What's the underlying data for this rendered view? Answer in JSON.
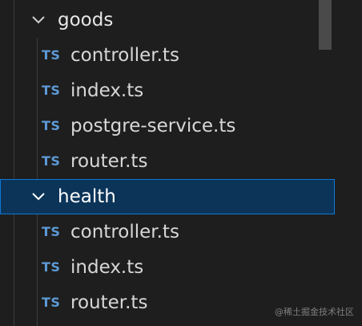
{
  "explorer": {
    "folders": [
      {
        "name": "goods",
        "expanded": true,
        "selected": false,
        "files": [
          {
            "icon": "TS",
            "name": "controller.ts"
          },
          {
            "icon": "TS",
            "name": "index.ts"
          },
          {
            "icon": "TS",
            "name": "postgre-service.ts"
          },
          {
            "icon": "TS",
            "name": "router.ts"
          }
        ]
      },
      {
        "name": "health",
        "expanded": true,
        "selected": true,
        "files": [
          {
            "icon": "TS",
            "name": "controller.ts"
          },
          {
            "icon": "TS",
            "name": "index.ts"
          },
          {
            "icon": "TS",
            "name": "router.ts"
          }
        ]
      }
    ]
  },
  "colors": {
    "background": "#1e1e1e",
    "selection_background": "#0b3458",
    "selection_border": "#0f78d4",
    "ts_icon": "#5d9ad6",
    "text": "#d7d7d7"
  },
  "watermark": "@稀土掘金技术社区"
}
